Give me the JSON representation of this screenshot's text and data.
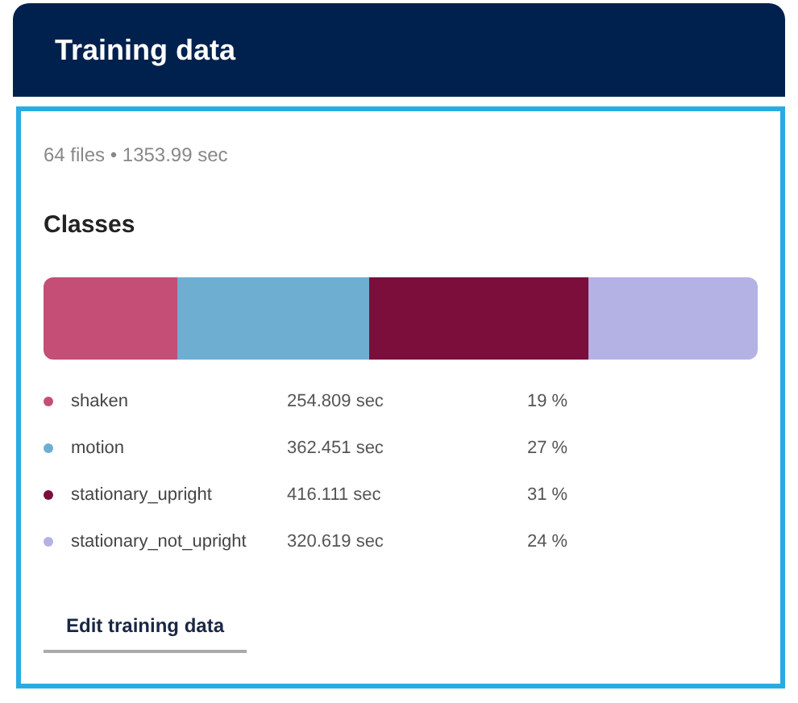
{
  "header": {
    "title": "Training data"
  },
  "summary": "64 files • 1353.99 sec",
  "classes_title": "Classes",
  "classes": [
    {
      "name": "shaken",
      "duration": "254.809 sec",
      "percent": "19 %",
      "color": "#c44e76"
    },
    {
      "name": "motion",
      "duration": "362.451 sec",
      "percent": "27 %",
      "color": "#6eaed1"
    },
    {
      "name": "stationary_upright",
      "duration": "416.111 sec",
      "percent": "31 %",
      "color": "#7b0e3b"
    },
    {
      "name": "stationary_not_upright",
      "duration": "320.619 sec",
      "percent": "24 %",
      "color": "#b4b1e4"
    }
  ],
  "edit_button": "Edit training data"
}
